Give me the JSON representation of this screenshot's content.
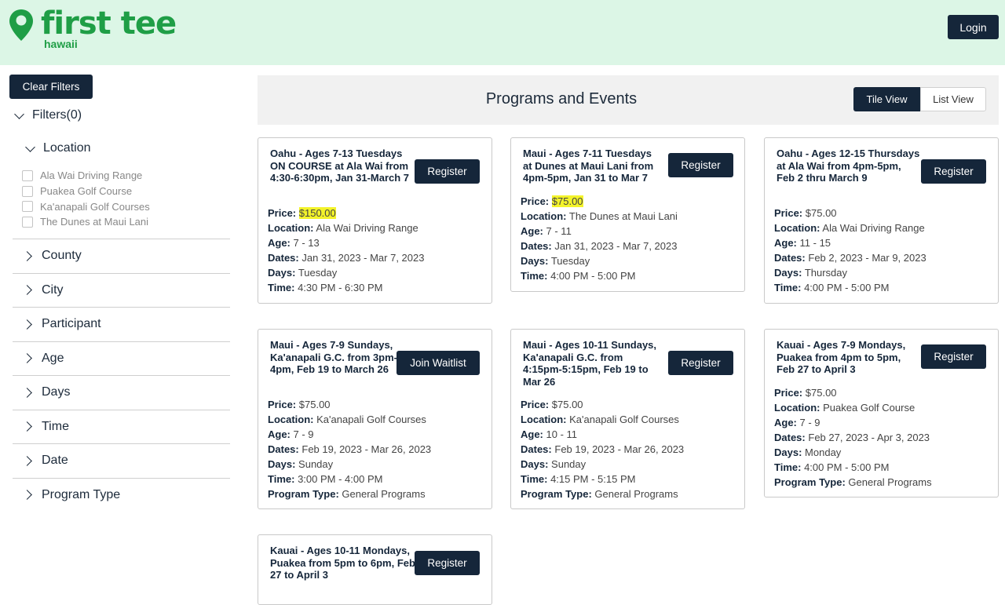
{
  "brand": {
    "name": "first tee",
    "sub": "hawaii",
    "color": "#1f9e46"
  },
  "header": {
    "login": "Login"
  },
  "sidebar": {
    "clear": "Clear Filters",
    "filters": "Filters(0)",
    "location": "Location",
    "locations": [
      "Ala Wai Driving Range",
      "Puakea Golf Course",
      "Ka'anapali Golf Courses",
      "The Dunes at Maui Lani"
    ],
    "sections": [
      "County",
      "City",
      "Participant",
      "Age",
      "Days",
      "Time",
      "Date",
      "Program Type"
    ]
  },
  "main": {
    "title": "Programs and Events",
    "tile_view": "Tile View",
    "list_view": "List View"
  },
  "labels": {
    "price": "Price:",
    "location": "Location:",
    "age": "Age:",
    "dates": "Dates:",
    "days": "Days:",
    "time": "Time:",
    "program_type": "Program Type:"
  },
  "cards": [
    {
      "title": "Oahu - Ages 7-13 Tuesdays ON COURSE at Ala Wai from 4:30-6:30pm, Jan 31-March 7",
      "button": "Register",
      "price": "$150.00",
      "location": "Ala Wai Driving Range",
      "age": "7 - 13",
      "dates": "Jan 31, 2023 - Mar 7, 2023",
      "days": "Tuesday",
      "time": "4:30 PM - 6:30 PM"
    },
    {
      "title": "Maui - Ages 7-11 Tuesdays at Dunes at Maui Lani from 4pm-5pm, Jan 31 to Mar 7",
      "button": "Register",
      "price": "$75.00",
      "location": "The Dunes at Maui Lani",
      "age": "7 - 11",
      "dates": "Jan 31, 2023 - Mar 7, 2023",
      "days": "Tuesday",
      "time": "4:00 PM - 5:00 PM"
    },
    {
      "title": "Oahu - Ages 12-15 Thursdays at Ala Wai from 4pm-5pm, Feb 2 thru March 9",
      "button": "Register",
      "price": "$75.00",
      "location": "Ala Wai Driving Range",
      "age": "11 - 15",
      "dates": "Feb 2, 2023 - Mar 9, 2023",
      "days": "Thursday",
      "time": "4:00 PM - 5:00 PM"
    },
    {
      "title": "Maui - Ages 7-9 Sundays, Ka'anapali G.C. from 3pm-4pm, Feb 19 to March 26",
      "button": "Join Waitlist",
      "price": "$75.00",
      "location": "Ka'anapali Golf Courses",
      "age": "7 - 9",
      "dates": "Feb 19, 2023 - Mar 26, 2023",
      "days": "Sunday",
      "time": "3:00 PM - 4:00 PM",
      "program_type": "General Programs"
    },
    {
      "title": "Maui - Ages 10-11 Sundays, Ka'anapali G.C. from 4:15pm-5:15pm, Feb 19 to Mar 26",
      "button": "Register",
      "price": "$75.00",
      "location": "Ka'anapali Golf Courses",
      "age": "10 - 11",
      "dates": "Feb 19, 2023 - Mar 26, 2023",
      "days": "Sunday",
      "time": "4:15 PM - 5:15 PM",
      "program_type": "General Programs"
    },
    {
      "title": "Kauai - Ages 7-9 Mondays, Puakea from 4pm to 5pm, Feb 27 to April 3",
      "button": "Register",
      "price": "$75.00",
      "location": "Puakea Golf Course",
      "age": "7 - 9",
      "dates": "Feb 27, 2023 - Apr 3, 2023",
      "days": "Monday",
      "time": "4:00 PM - 5:00 PM",
      "program_type": "General Programs"
    },
    {
      "title": "Kauai - Ages 10-11 Mondays, Puakea from 5pm to 6pm, Feb 27 to April 3",
      "button": "Register"
    }
  ]
}
